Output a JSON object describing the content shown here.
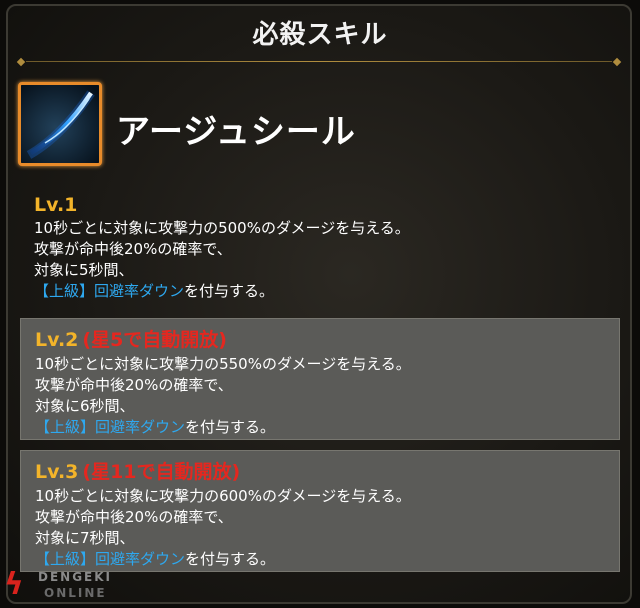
{
  "header": {
    "title": "必殺スキル"
  },
  "skill": {
    "name": "アージュシール",
    "icon": "blue-slash-icon"
  },
  "levels": [
    {
      "level": "Lv.1",
      "unlock": "",
      "line1": "10秒ごとに対象に攻撃力の500%のダメージを与える。",
      "line2": "攻撃が命中後20%の確率で、",
      "line3": "対象に5秒間、",
      "effect_blue": "【上級】回避率ダウン",
      "effect_suffix": "を付与する。"
    },
    {
      "level": "Lv.2",
      "unlock": "(星5で自動開放)",
      "line1": "10秒ごとに対象に攻撃力の550%のダメージを与える。",
      "line2": "攻撃が命中後20%の確率で、",
      "line3": "対象に6秒間、",
      "effect_blue": "【上級】回避率ダウン",
      "effect_suffix": "を付与する。"
    },
    {
      "level": "Lv.3",
      "unlock": "(星11で自動開放)",
      "line1": "10秒ごとに対象に攻撃力の600%のダメージを与える。",
      "line2": "攻撃が命中後20%の確率で、",
      "line3": "対象に7秒間、",
      "effect_blue": "【上級】回避率ダウン",
      "effect_suffix": "を付与する。"
    }
  ],
  "watermark": {
    "line1": "DENGEKI",
    "line2": "ONLINE"
  },
  "colors": {
    "level_label": "#f3b42a",
    "unlock_text": "#e5271f",
    "effect_text": "#2ea8ef",
    "icon_border": "#e88b2a"
  }
}
